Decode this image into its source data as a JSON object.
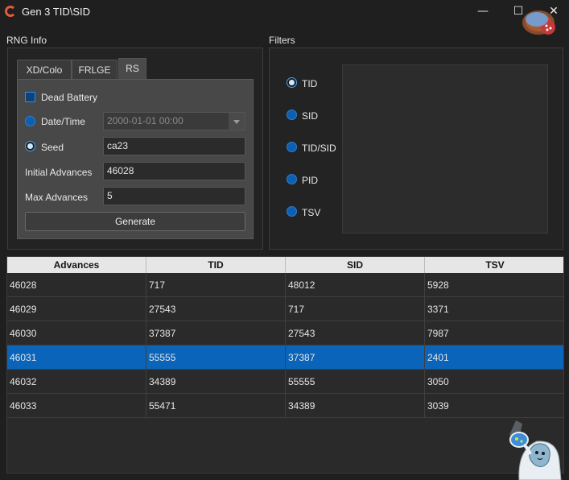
{
  "window": {
    "title": "Gen 3 TID\\SID",
    "minimize_glyph": "—",
    "maximize_glyph": "☐",
    "close_glyph": "✕"
  },
  "rng_info": {
    "section_label": "RNG Info",
    "tabs": [
      {
        "label": "XD/Colo"
      },
      {
        "label": "FRLGE"
      },
      {
        "label": "RS",
        "active": true
      }
    ],
    "dead_battery_label": "Dead Battery",
    "date_time_label": "Date/Time",
    "date_time_value": "2000-01-01 00:00",
    "seed_label": "Seed",
    "seed_value": "ca23",
    "initial_advances_label": "Initial Advances",
    "initial_advances_value": "46028",
    "max_advances_label": "Max Advances",
    "max_advances_value": "5",
    "generate_label": "Generate"
  },
  "filters": {
    "section_label": "Filters",
    "options": [
      {
        "label": "TID",
        "checked": true
      },
      {
        "label": "SID"
      },
      {
        "label": "TID/SID"
      },
      {
        "label": "PID"
      },
      {
        "label": "TSV"
      }
    ]
  },
  "results": {
    "columns": [
      "Advances",
      "TID",
      "SID",
      "TSV"
    ],
    "rows": [
      [
        "46028",
        "717",
        "48012",
        "5928"
      ],
      [
        "46029",
        "27543",
        "717",
        "3371"
      ],
      [
        "46030",
        "37387",
        "27543",
        "7987"
      ],
      [
        "46031",
        "55555",
        "37387",
        "2401"
      ],
      [
        "46032",
        "34389",
        "55555",
        "3050"
      ],
      [
        "46033",
        "55471",
        "34389",
        "3039"
      ]
    ],
    "selected_row": 3
  },
  "colors": {
    "accent": "#0a64b9",
    "brand_icon": "#e25b3a",
    "background": "#1f1f1f"
  },
  "icons": {
    "app": "app-logo-icon",
    "mascot": "pokefinder-mascot-icon"
  }
}
